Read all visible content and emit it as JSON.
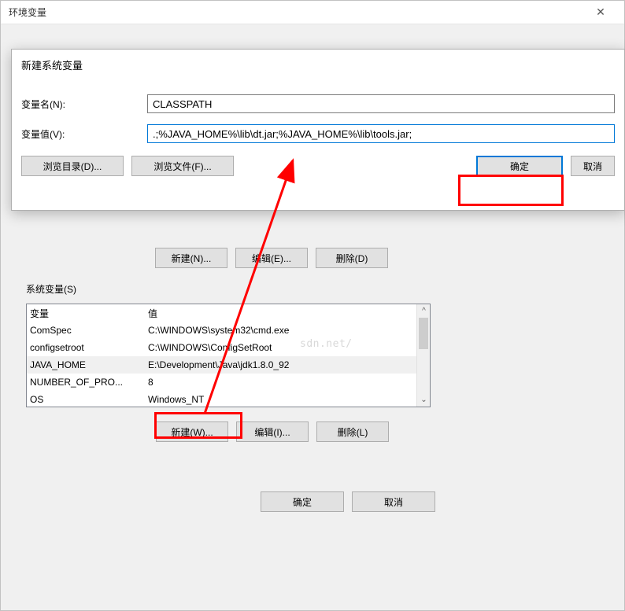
{
  "outer_window": {
    "title": "环境变量"
  },
  "bg_buttons": {
    "new_label": "新建(N)...",
    "edit_label": "编辑(E)...",
    "delete_label": "删除(D)"
  },
  "sys_group": {
    "label": "系统变量(S)",
    "header_var": "变量",
    "header_val": "值",
    "rows": [
      {
        "var": "ComSpec",
        "val": "C:\\WINDOWS\\system32\\cmd.exe"
      },
      {
        "var": "configsetroot",
        "val": "C:\\WINDOWS\\ConfigSetRoot"
      },
      {
        "var": "JAVA_HOME",
        "val": "E:\\Development\\Java\\jdk1.8.0_92"
      },
      {
        "var": "NUMBER_OF_PRO...",
        "val": "8"
      },
      {
        "var": "OS",
        "val": "Windows_NT"
      }
    ],
    "new_label": "新建(W)...",
    "edit_label": "编辑(I)...",
    "delete_label": "删除(L)"
  },
  "bottom": {
    "ok_label": "确定",
    "cancel_label": "取消"
  },
  "modal": {
    "title": "新建系统变量",
    "name_label": "变量名(N):",
    "value_label": "变量值(V):",
    "name_value": "CLASSPATH",
    "val_value": ".;%JAVA_HOME%\\lib\\dt.jar;%JAVA_HOME%\\lib\\tools.jar;",
    "browse_dir_label": "浏览目录(D)...",
    "browse_file_label": "浏览文件(F)...",
    "ok_label": "确定",
    "cancel_label": "取消"
  },
  "watermark": "sdn.net/"
}
